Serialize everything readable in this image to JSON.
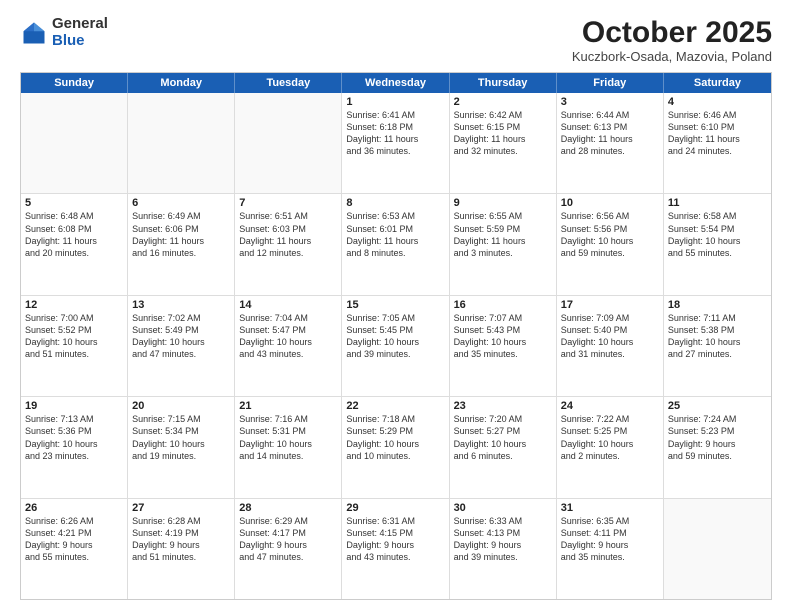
{
  "header": {
    "logo_general": "General",
    "logo_blue": "Blue",
    "month_title": "October 2025",
    "location": "Kuczbork-Osada, Mazovia, Poland"
  },
  "weekdays": [
    "Sunday",
    "Monday",
    "Tuesday",
    "Wednesday",
    "Thursday",
    "Friday",
    "Saturday"
  ],
  "rows": [
    [
      {
        "day": "",
        "text": ""
      },
      {
        "day": "",
        "text": ""
      },
      {
        "day": "",
        "text": ""
      },
      {
        "day": "1",
        "text": "Sunrise: 6:41 AM\nSunset: 6:18 PM\nDaylight: 11 hours\nand 36 minutes."
      },
      {
        "day": "2",
        "text": "Sunrise: 6:42 AM\nSunset: 6:15 PM\nDaylight: 11 hours\nand 32 minutes."
      },
      {
        "day": "3",
        "text": "Sunrise: 6:44 AM\nSunset: 6:13 PM\nDaylight: 11 hours\nand 28 minutes."
      },
      {
        "day": "4",
        "text": "Sunrise: 6:46 AM\nSunset: 6:10 PM\nDaylight: 11 hours\nand 24 minutes."
      }
    ],
    [
      {
        "day": "5",
        "text": "Sunrise: 6:48 AM\nSunset: 6:08 PM\nDaylight: 11 hours\nand 20 minutes."
      },
      {
        "day": "6",
        "text": "Sunrise: 6:49 AM\nSunset: 6:06 PM\nDaylight: 11 hours\nand 16 minutes."
      },
      {
        "day": "7",
        "text": "Sunrise: 6:51 AM\nSunset: 6:03 PM\nDaylight: 11 hours\nand 12 minutes."
      },
      {
        "day": "8",
        "text": "Sunrise: 6:53 AM\nSunset: 6:01 PM\nDaylight: 11 hours\nand 8 minutes."
      },
      {
        "day": "9",
        "text": "Sunrise: 6:55 AM\nSunset: 5:59 PM\nDaylight: 11 hours\nand 3 minutes."
      },
      {
        "day": "10",
        "text": "Sunrise: 6:56 AM\nSunset: 5:56 PM\nDaylight: 10 hours\nand 59 minutes."
      },
      {
        "day": "11",
        "text": "Sunrise: 6:58 AM\nSunset: 5:54 PM\nDaylight: 10 hours\nand 55 minutes."
      }
    ],
    [
      {
        "day": "12",
        "text": "Sunrise: 7:00 AM\nSunset: 5:52 PM\nDaylight: 10 hours\nand 51 minutes."
      },
      {
        "day": "13",
        "text": "Sunrise: 7:02 AM\nSunset: 5:49 PM\nDaylight: 10 hours\nand 47 minutes."
      },
      {
        "day": "14",
        "text": "Sunrise: 7:04 AM\nSunset: 5:47 PM\nDaylight: 10 hours\nand 43 minutes."
      },
      {
        "day": "15",
        "text": "Sunrise: 7:05 AM\nSunset: 5:45 PM\nDaylight: 10 hours\nand 39 minutes."
      },
      {
        "day": "16",
        "text": "Sunrise: 7:07 AM\nSunset: 5:43 PM\nDaylight: 10 hours\nand 35 minutes."
      },
      {
        "day": "17",
        "text": "Sunrise: 7:09 AM\nSunset: 5:40 PM\nDaylight: 10 hours\nand 31 minutes."
      },
      {
        "day": "18",
        "text": "Sunrise: 7:11 AM\nSunset: 5:38 PM\nDaylight: 10 hours\nand 27 minutes."
      }
    ],
    [
      {
        "day": "19",
        "text": "Sunrise: 7:13 AM\nSunset: 5:36 PM\nDaylight: 10 hours\nand 23 minutes."
      },
      {
        "day": "20",
        "text": "Sunrise: 7:15 AM\nSunset: 5:34 PM\nDaylight: 10 hours\nand 19 minutes."
      },
      {
        "day": "21",
        "text": "Sunrise: 7:16 AM\nSunset: 5:31 PM\nDaylight: 10 hours\nand 14 minutes."
      },
      {
        "day": "22",
        "text": "Sunrise: 7:18 AM\nSunset: 5:29 PM\nDaylight: 10 hours\nand 10 minutes."
      },
      {
        "day": "23",
        "text": "Sunrise: 7:20 AM\nSunset: 5:27 PM\nDaylight: 10 hours\nand 6 minutes."
      },
      {
        "day": "24",
        "text": "Sunrise: 7:22 AM\nSunset: 5:25 PM\nDaylight: 10 hours\nand 2 minutes."
      },
      {
        "day": "25",
        "text": "Sunrise: 7:24 AM\nSunset: 5:23 PM\nDaylight: 9 hours\nand 59 minutes."
      }
    ],
    [
      {
        "day": "26",
        "text": "Sunrise: 6:26 AM\nSunset: 4:21 PM\nDaylight: 9 hours\nand 55 minutes."
      },
      {
        "day": "27",
        "text": "Sunrise: 6:28 AM\nSunset: 4:19 PM\nDaylight: 9 hours\nand 51 minutes."
      },
      {
        "day": "28",
        "text": "Sunrise: 6:29 AM\nSunset: 4:17 PM\nDaylight: 9 hours\nand 47 minutes."
      },
      {
        "day": "29",
        "text": "Sunrise: 6:31 AM\nSunset: 4:15 PM\nDaylight: 9 hours\nand 43 minutes."
      },
      {
        "day": "30",
        "text": "Sunrise: 6:33 AM\nSunset: 4:13 PM\nDaylight: 9 hours\nand 39 minutes."
      },
      {
        "day": "31",
        "text": "Sunrise: 6:35 AM\nSunset: 4:11 PM\nDaylight: 9 hours\nand 35 minutes."
      },
      {
        "day": "",
        "text": ""
      }
    ]
  ]
}
